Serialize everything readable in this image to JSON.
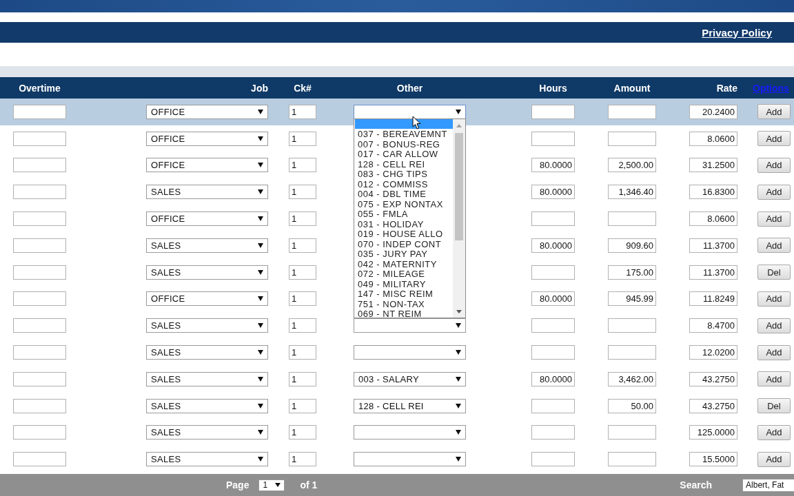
{
  "banner": {
    "link": "Privacy Policy"
  },
  "columns": [
    {
      "label": "Overtime",
      "kind": "header"
    },
    {
      "label": "Job",
      "kind": "header"
    },
    {
      "label": "Ck#",
      "kind": "header"
    },
    {
      "label": "Other",
      "kind": "header"
    },
    {
      "label": "Hours",
      "kind": "header"
    },
    {
      "label": "Amount",
      "kind": "header"
    },
    {
      "label": "Rate",
      "kind": "header"
    },
    {
      "label": "Options",
      "kind": "link"
    }
  ],
  "rows": [
    {
      "selected": true,
      "job": "OFFICE",
      "ck": "1",
      "other": {
        "kind": "select",
        "open": true,
        "blank_highlighted": true,
        "options": [
          "037 - BEREAVEMNT",
          "007 - BONUS-REG",
          "017 - CAR ALLOW",
          "128 - CELL REI",
          "083 - CHG TIPS",
          "012 - COMMISS",
          "004 - DBL TIME",
          "075 - EXP NONTAX",
          "055 - FMLA",
          "031 - HOLIDAY",
          "019 - HOUSE ALLO",
          "070 - INDEP CONT",
          "035 - JURY PAY",
          "042 - MATERNITY",
          "072 - MILEAGE",
          "049 - MILITARY",
          "147 - MISC REIM",
          "751 - NON-TAX",
          "069 - NT REIM"
        ]
      },
      "rate": "20.2400",
      "action": "Add"
    },
    {
      "selected": false,
      "job": "OFFICE",
      "ck": "1",
      "rate": "8.0600",
      "action": "Add"
    },
    {
      "selected": false,
      "job": "OFFICE",
      "ck": "1",
      "hours": "80.0000",
      "amount": "2,500.00",
      "rate": "31.2500",
      "action": "Add"
    },
    {
      "selected": false,
      "job": "SALES",
      "ck": "1",
      "hours": "80.0000",
      "amount": "1,346.40",
      "rate": "16.8300",
      "action": "Add"
    },
    {
      "selected": false,
      "job": "OFFICE",
      "ck": "1",
      "rate": "8.0600",
      "action": "Add"
    },
    {
      "selected": false,
      "job": "SALES",
      "ck": "1",
      "hours": "80.0000",
      "amount": "909.60",
      "rate": "11.3700",
      "action": "Add"
    },
    {
      "selected": false,
      "job": "SALES",
      "ck": "1",
      "amount": "175.00",
      "rate": "11.3700",
      "action": "Del"
    },
    {
      "selected": false,
      "job": "OFFICE",
      "ck": "1",
      "hours": "80.0000",
      "amount": "945.99",
      "rate": "11.8249",
      "action": "Add"
    },
    {
      "selected": false,
      "job": "SALES",
      "ck": "1",
      "other": {
        "kind": "select"
      },
      "rate": "8.4700",
      "action": "Add"
    },
    {
      "selected": false,
      "job": "SALES",
      "ck": "1",
      "other": {
        "kind": "select"
      },
      "rate": "12.0200",
      "action": "Add"
    },
    {
      "selected": false,
      "job": "SALES",
      "ck": "1",
      "other": {
        "kind": "select",
        "value": "003 - SALARY"
      },
      "hours": "80.0000",
      "amount": "3,462.00",
      "rate": "43.2750",
      "action": "Add"
    },
    {
      "selected": false,
      "job": "SALES",
      "ck": "1",
      "other": {
        "kind": "select",
        "value": "128 - CELL REI"
      },
      "amount": "50.00",
      "rate": "43.2750",
      "action": "Del"
    },
    {
      "selected": false,
      "job": "SALES",
      "ck": "1",
      "other": {
        "kind": "select"
      },
      "rate": "125.0000",
      "action": "Add"
    },
    {
      "selected": false,
      "job": "SALES",
      "ck": "1",
      "other": {
        "kind": "select"
      },
      "rate": "15.5000",
      "action": "Add"
    }
  ],
  "pager": {
    "page_label": "Page",
    "page": "1",
    "of": "of 1",
    "search_label": "Search",
    "search_value": "Albert, Fat"
  }
}
